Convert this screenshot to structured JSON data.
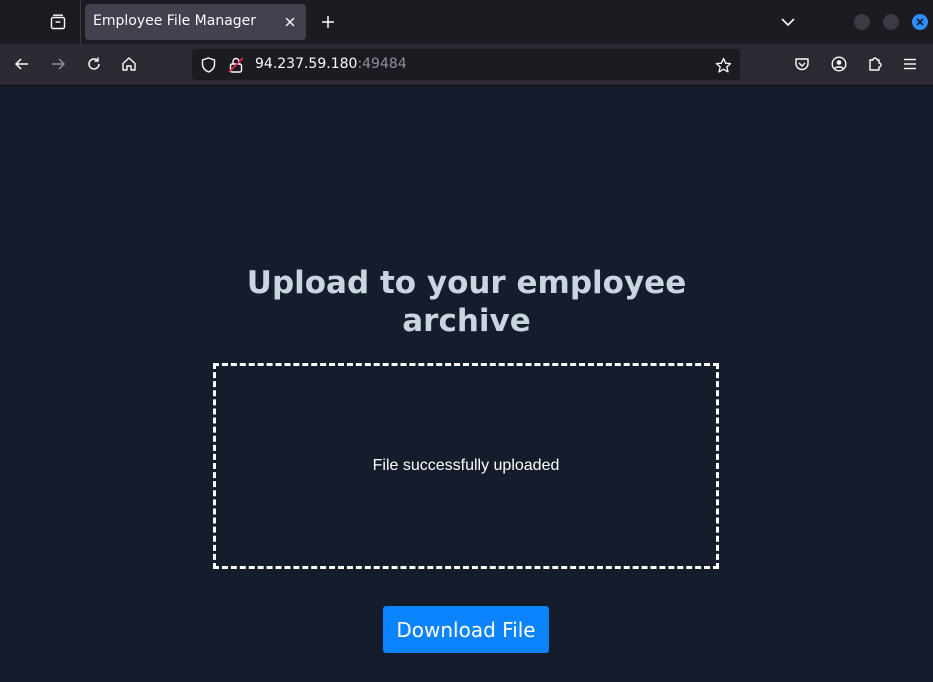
{
  "browser": {
    "tab": {
      "title": "Employee File Manager"
    },
    "url": {
      "host": "94.237.59.180",
      "port": ":49484"
    },
    "icons": {
      "tab_list": "tab-list-icon",
      "close_tab": "close-icon",
      "new_tab": "plus-icon",
      "tabs_overflow": "chevron-down-icon",
      "back": "back-arrow-icon",
      "forward": "forward-arrow-icon",
      "reload": "reload-icon",
      "home": "home-icon",
      "tracking_protection": "shield-icon",
      "insecure": "lock-warning-icon",
      "bookmark": "star-icon",
      "pocket": "pocket-icon",
      "account": "account-icon",
      "extensions": "puzzle-icon",
      "menu": "hamburger-menu-icon"
    },
    "colors": {
      "accent": "#2f8cff"
    }
  },
  "page": {
    "heading": "Upload to your employee archive",
    "dropzone_message": "File successfully uploaded",
    "download_button": "Download File",
    "colors": {
      "background": "#151c2b",
      "heading": "#cbd5e1",
      "button": "#0d84ff"
    }
  }
}
